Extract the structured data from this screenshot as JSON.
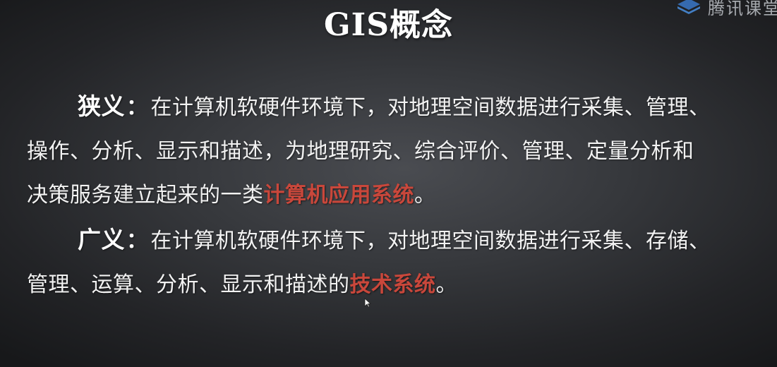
{
  "slide": {
    "title": "GIS概念",
    "narrow": {
      "term": "狭义",
      "colon": "：",
      "lines": [
        "在计算机软硬件环境下，对地理空间数据进行采集、管理、",
        "操作、分析、显示和描述，为地理研究、综合评价、管理、定量分析和"
      ],
      "last_line_prefix": "决策服务建立起来的一类",
      "highlight": "计算机应用系统",
      "end": "。"
    },
    "broad": {
      "term": "广义",
      "colon": "：",
      "lines": [
        "在计算机软硬件环境下，对地理空间数据进行采集、存储、"
      ],
      "last_line_prefix": "管理、运算、分析、显示和描述的",
      "highlight": "技术系统",
      "end": "。"
    }
  },
  "watermark": {
    "text": "腾讯课堂",
    "icon": "tencent-classroom-logo-icon"
  },
  "colors": {
    "highlight": "#c9473b",
    "text": "#ffffff",
    "background": "#36383c"
  }
}
